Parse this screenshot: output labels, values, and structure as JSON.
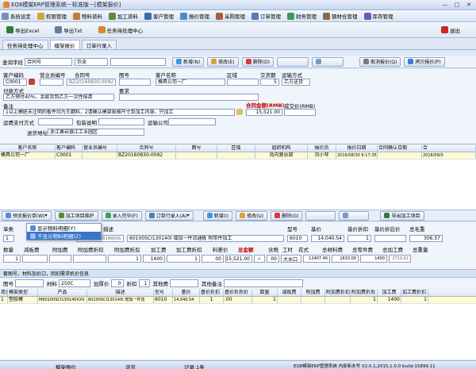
{
  "window": {
    "title": "EQ8模架ERP管理系统－标准版－[模架报价]",
    "buttons": [
      "—",
      "□",
      "✕"
    ]
  },
  "menu": [
    "系统设定",
    "权限管理",
    "物料资料",
    "加工资料",
    "客户管理",
    "报价管理",
    "采购管理",
    "订单管理",
    "财务管理",
    "钢材仓管理",
    "库存管理"
  ],
  "toolbar": {
    "export_excel": "导出Excel",
    "export_txt": "导出Txt",
    "task_center": "任务待处理中心",
    "exit": "退出"
  },
  "tabs": [
    "任务待处理中心",
    "模架报价",
    "订单行录入"
  ],
  "query": {
    "label": "查询字段",
    "field": "合同号",
    "op": "包含",
    "new": "新增(N)",
    "edit": "修改(E)",
    "delete": "删除(D)",
    "cancel": "取消报价(Q)",
    "copy": "拷贝报价(P)"
  },
  "form": {
    "labels": {
      "customer_code": "客户编码",
      "salesman": "营业员编号",
      "contract": "合同号",
      "drawing": "图号",
      "customer_name": "客户名称",
      "region": "区域",
      "delivery": "交货期",
      "shipping": "运输方式",
      "payment": "付款方式",
      "requirements": "要求",
      "remarks": "备注",
      "contract_amount": "合同金额(RMB)",
      "deal_price": "成交价(RMB)",
      "freight_pay": "运费支付方式",
      "packing": "包装说明",
      "carrier": "运输公司",
      "address_label": "送货地址"
    },
    "customer_code": "C0001",
    "contract": "BZ20160830-0092",
    "customer_name": "模具公司一厂",
    "delivery": "5",
    "shipping": "乙方送货",
    "payment": "乙方预付40%，余款货到乙方一次性结清",
    "remarks": "1以上模胚未注明的板件均为王鋼料，2请确认模架规格尺寸及加工内容，只加工",
    "amount": "15,521.00",
    "address": "浙江黄岩银江工业园区"
  },
  "order_grid": {
    "headers": [
      "客户名称",
      "客户编码",
      "营业员编号",
      "合同号",
      "图号",
      "区域",
      "组织机构",
      "报价员",
      "报价日期",
      "合同确认日期",
      "合"
    ],
    "rows": [
      [
        "模具公司一厂",
        "C0001",
        "",
        "BZ20160830-0092",
        "",
        "",
        "岛内营业部",
        "刘小琴",
        "2016/08/30 9:17:35",
        "",
        "2016/09/0"
      ]
    ]
  },
  "detail_bar": {
    "preview": "预览报价单(W)",
    "process": "加工项目维护",
    "entry_done": "录入完毕(F)",
    "order_entry": "订单行录入(A)",
    "new": "新增(I)",
    "edit": "修改(U)",
    "delete": "删除(G)",
    "export": "导出加工项目"
  },
  "popup": [
    "显示物料明细(Y)",
    "不显示物料明细(Z)"
  ],
  "detail": {
    "labels1": [
      "单类",
      "产品",
      "描述",
      "型号",
      "基价",
      "基价折扣",
      "基价折后价",
      "总毛重"
    ],
    "values1": [
      "1",
      "60100SCI130140XXS",
      "60100SCI130140I 增加一件流通板 附带件加工",
      "6010",
      "14,040.54",
      "1",
      "",
      "306.57"
    ],
    "labels2": [
      "数量",
      "减板费",
      "附加费",
      "附加费折扣",
      "附加费折后",
      "加工费",
      "加工费折扣",
      "料差价",
      "总金额",
      "含税",
      "工时",
      "花式",
      "总材料费",
      "总零件费",
      "总加工费",
      "总重量"
    ],
    "values2": [
      "1",
      "",
      "",
      "",
      "1",
      "1400",
      "1",
      "00",
      "15,521.00",
      "✓",
      "00",
      "大水口",
      "12407.46",
      "1633.00",
      "1400",
      "2719.62"
    ]
  },
  "info_bar": "套图号，材料加价口，回扣需求机价信息",
  "info_row": {
    "drawing": "图号",
    "material": "材料",
    "material_val": "250C",
    "markup": "加厚价",
    "markup_val": "0",
    "discount": "折扣",
    "discount_val": "1",
    "other": "其他费",
    "note": "其他备注"
  },
  "item_grid": {
    "headers": [
      "单类",
      "模架类型",
      "产品",
      "描述",
      "型号",
      "基价",
      "基价折扣",
      "基价折后价",
      "数量",
      "减板费",
      "附加费",
      "附加费折扣",
      "附加费折后",
      "加工费",
      "加工费折扣"
    ],
    "rows": [
      [
        "1",
        "塑胶模",
        "M60100SCI130140XXS",
        "60100SCI130140I 增加一件流",
        "6010",
        "14,040.54",
        "1",
        ".00",
        "1",
        "",
        "",
        "",
        "1",
        "1400",
        "1"
      ]
    ]
  },
  "status": {
    "s1": "模架报价",
    "s2": "浏览",
    "s3": "记录:1条",
    "s4": "EQ8模架ERP管理系统 内部新本号 V2.0.1,2015,1.0.0 build-15899.11"
  },
  "colors": {
    "accent": "#3a74c9",
    "amount": "#c00000",
    "selected_row": "#fffbd1"
  }
}
